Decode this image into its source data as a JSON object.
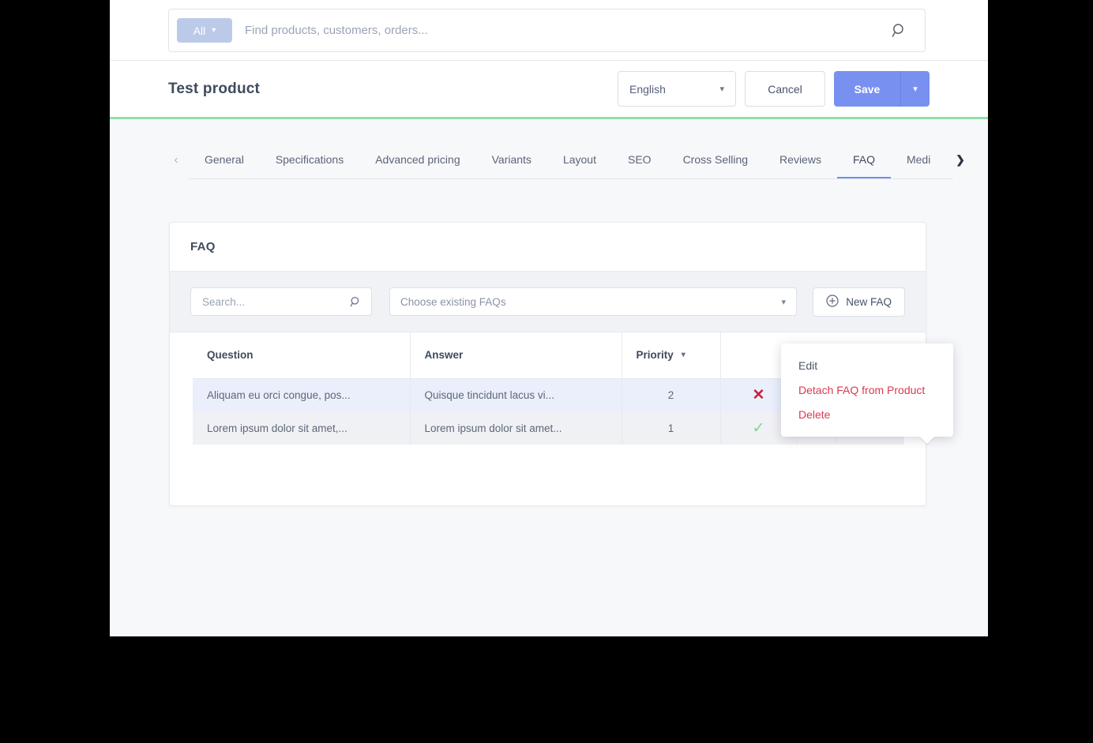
{
  "topbar": {
    "scope_label": "All",
    "scope_chevron": "chevron-down-icon",
    "search_placeholder": "Find products, customers, orders...",
    "search_value": "",
    "search_icon": "search-icon"
  },
  "header": {
    "title": "Test product",
    "language": "English",
    "cancel_label": "Cancel",
    "save_label": "Save",
    "save_dropdown_icon": "chevron-down-icon",
    "accent_line_color": "#8fe0a8",
    "save_color": "#7891f0"
  },
  "tabs": {
    "prev_icon": "chevron-left-icon",
    "next_icon": "chevron-right-icon",
    "active": "FAQ",
    "items": [
      {
        "label": "General",
        "active": false
      },
      {
        "label": "Specifications",
        "active": false
      },
      {
        "label": "Advanced pricing",
        "active": false
      },
      {
        "label": "Variants",
        "active": false
      },
      {
        "label": "Layout",
        "active": false
      },
      {
        "label": "SEO",
        "active": false
      },
      {
        "label": "Cross Selling",
        "active": false
      },
      {
        "label": "Reviews",
        "active": false
      },
      {
        "label": "FAQ",
        "active": true
      },
      {
        "label": "Medi",
        "active": false
      }
    ]
  },
  "card": {
    "title": "FAQ",
    "toolbar": {
      "search_placeholder": "Search...",
      "search_value": "",
      "search_icon": "search-icon",
      "select_placeholder": "Choose existing FAQs",
      "select_chevron": "chevron-down-icon",
      "new_faq_label": "New FAQ",
      "new_faq_icon": "plus-circle-icon"
    },
    "table": {
      "columns": [
        {
          "label": "Question",
          "sortable": false
        },
        {
          "label": "Answer",
          "sortable": false
        },
        {
          "label": "Priority",
          "sortable": true
        },
        {
          "label": "",
          "sortable": false
        },
        {
          "label": "",
          "sortable": false
        },
        {
          "label": "",
          "sortable": false
        }
      ],
      "rows": [
        {
          "question": "Aliquam eu orci congue, pos...",
          "answer": "Quisque tincidunt lacus vi...",
          "priority": "2",
          "status": "x-icon",
          "extra": "",
          "actions": "ellipsis-icon",
          "selected": true
        },
        {
          "question": "Lorem ipsum dolor sit amet,...",
          "answer": "Lorem ipsum dolor sit amet...",
          "priority": "1",
          "status": "check-icon",
          "extra": "",
          "actions": "ellipsis-icon",
          "selected": false
        }
      ]
    }
  },
  "context_menu": {
    "items": [
      {
        "label": "Edit",
        "danger": false
      },
      {
        "label": "Detach FAQ from Product",
        "danger": true
      },
      {
        "label": "Delete",
        "danger": true
      }
    ],
    "danger_color": "#d83a52"
  }
}
